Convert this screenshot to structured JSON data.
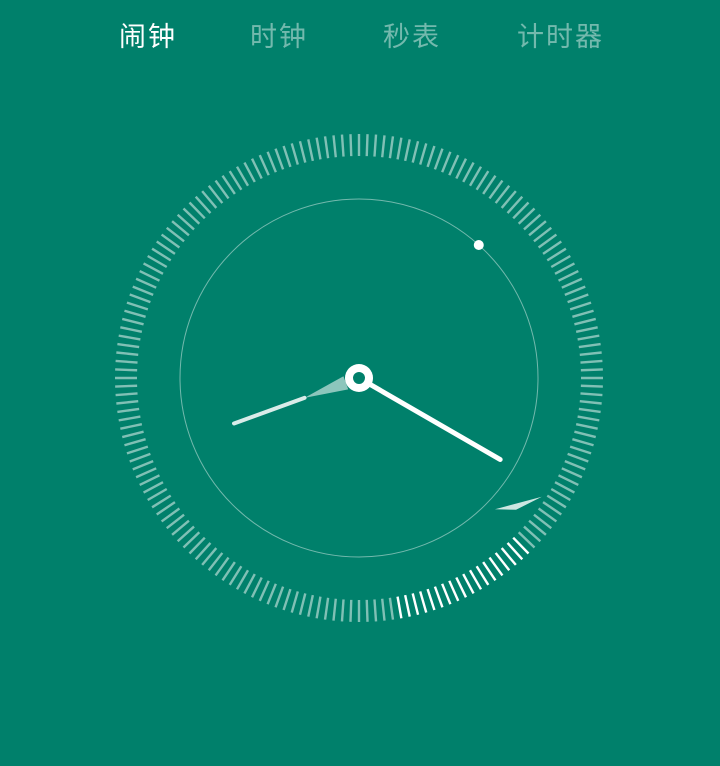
{
  "tabs": [
    {
      "label": "闹钟",
      "active": true
    },
    {
      "label": "时钟",
      "active": false
    },
    {
      "label": "秒表",
      "active": false
    },
    {
      "label": "计时器",
      "active": false
    }
  ],
  "colors": {
    "background": "#00806B",
    "tab_active": "#FFFFFF",
    "tab_inactive": "rgba(255,255,255,0.45)",
    "hand": "#FFFFFF",
    "tick": "#FFFFFF"
  },
  "clock": {
    "hour": 8,
    "minute": 20,
    "second_dot_minute": 7,
    "highlight_minute_start": 22.5,
    "highlight_minute_end": 28.5
  }
}
